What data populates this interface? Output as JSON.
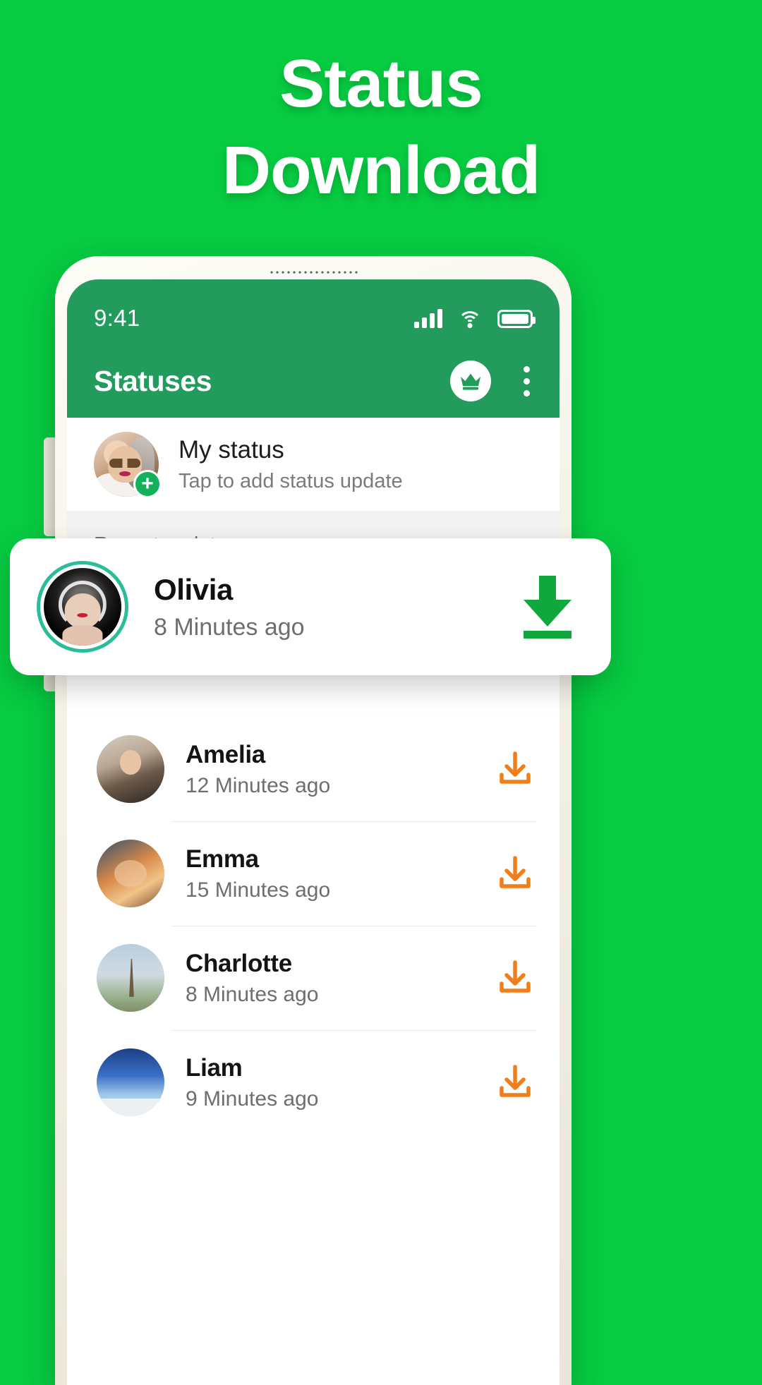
{
  "headline": {
    "line1": "Status",
    "line2": "Download"
  },
  "colors": {
    "background_green": "#07cb41",
    "appbar_green": "#229b5d",
    "accent_teal": "#2bbd9a",
    "download_orange": "#f07f1a",
    "download_green": "#0fa83c",
    "plus_green": "#12b15b"
  },
  "phone": {
    "statusbar": {
      "time": "9:41",
      "icons": [
        "signal-icon",
        "wifi-icon",
        "battery-icon"
      ]
    },
    "appbar": {
      "title": "Statuses",
      "premium_icon": "crown-icon",
      "menu_icon": "kebab-menu-icon"
    },
    "my_status": {
      "title": "My status",
      "subtitle": "Tap to add status update",
      "add_icon": "plus-icon"
    },
    "section_label": "Recent updates",
    "highlighted": {
      "name": "Olivia",
      "time": "8 Minutes ago",
      "download_icon": "download-icon"
    },
    "rows": [
      {
        "name": "Amelia",
        "time": "12 Minutes ago",
        "download_icon": "download-icon",
        "avatar_class": "av-amelia"
      },
      {
        "name": "Emma",
        "time": "15 Minutes ago",
        "download_icon": "download-icon",
        "avatar_class": "av-emma"
      },
      {
        "name": "Charlotte",
        "time": "8 Minutes ago",
        "download_icon": "download-icon",
        "avatar_class": "av-charlotte"
      },
      {
        "name": "Liam",
        "time": "9 Minutes ago",
        "download_icon": "download-icon",
        "avatar_class": "av-liam"
      }
    ]
  }
}
